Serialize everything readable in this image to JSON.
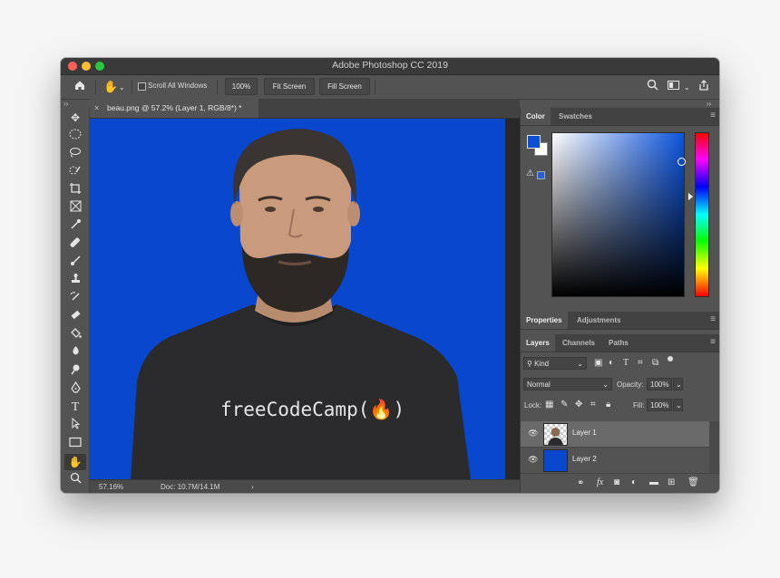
{
  "window": {
    "title": "Adobe Photoshop CC 2019"
  },
  "options_bar": {
    "home_icon": "home-icon",
    "hand_icon": "hand-icon",
    "scroll_all_windows_label": "Scroll All Windows",
    "zoom_button": "100%",
    "fit_screen_button": "Fit Screen",
    "fill_screen_button": "Fill Screen"
  },
  "document": {
    "tab_title": "beau.png @ 57.2% (Layer 1, RGB/8*) *",
    "tab_close": "×",
    "shirt_text": "freeCodeCamp(🔥)"
  },
  "status_bar": {
    "zoom": "57.16%",
    "doc_info": "Doc: 10.7M/14.1M",
    "arrow": "›"
  },
  "toolbar": {
    "tools": [
      "move-tool",
      "marquee-tool",
      "lasso-tool",
      "quick-selection-tool",
      "crop-tool",
      "frame-tool",
      "eyedropper-tool",
      "healing-brush-tool",
      "brush-tool",
      "clone-stamp-tool",
      "history-brush-tool",
      "eraser-tool",
      "paint-bucket-tool",
      "blur-tool",
      "dodge-tool",
      "pen-tool",
      "type-tool",
      "path-selection-tool",
      "rectangle-tool",
      "hand-tool",
      "zoom-tool"
    ],
    "type_glyph": "T"
  },
  "color_panel": {
    "tabs": [
      "Color",
      "Swatches"
    ],
    "foreground_color": "#0b4fd3",
    "background_color": "#ffffff"
  },
  "properties_panel": {
    "tabs": [
      "Properties",
      "Adjustments"
    ]
  },
  "layers_panel": {
    "tabs": [
      "Layers",
      "Channels",
      "Paths"
    ],
    "filter_kind": "Kind",
    "blend_mode": "Normal",
    "opacity_label": "Opacity:",
    "opacity_value": "100%",
    "lock_label": "Lock:",
    "fill_label": "Fill:",
    "fill_value": "100%",
    "layers": [
      {
        "name": "Layer 1",
        "selected": true
      },
      {
        "name": "Layer 2",
        "selected": false
      }
    ]
  },
  "colors": {
    "canvas_blue": "#0947cf",
    "panel_gray": "#535353"
  }
}
